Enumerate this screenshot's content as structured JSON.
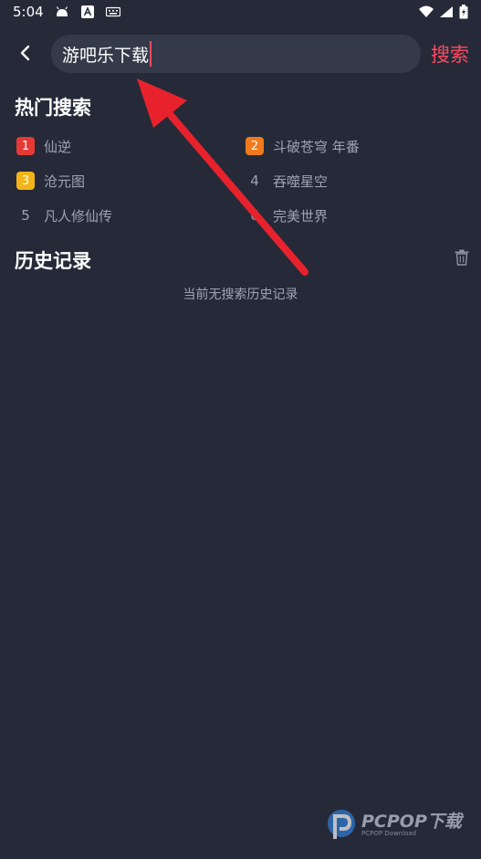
{
  "status_bar": {
    "time": "5:04",
    "left_icons": [
      "android-icon",
      "font-icon",
      "keyboard-icon"
    ],
    "right_icons": [
      "wifi-icon",
      "signal-icon",
      "battery-icon"
    ]
  },
  "search": {
    "value": "游吧乐下载",
    "button_label": "搜索"
  },
  "hot_search": {
    "title": "热门搜索",
    "items": [
      {
        "rank": "1",
        "label": "仙逆",
        "badge_color": "#e53935"
      },
      {
        "rank": "2",
        "label": "斗破苍穹 年番",
        "badge_color": "#f07a1c"
      },
      {
        "rank": "3",
        "label": "沧元图",
        "badge_color": "#f2b418"
      },
      {
        "rank": "4",
        "label": "吞噬星空"
      },
      {
        "rank": "5",
        "label": "凡人修仙传"
      },
      {
        "rank": "6",
        "label": "完美世界"
      }
    ]
  },
  "history": {
    "title": "历史记录",
    "empty_text": "当前无搜索历史记录"
  },
  "watermark": {
    "text": "PCPOP下载",
    "subtext": "PCPOP Download"
  },
  "colors": {
    "background": "#262a38",
    "accent": "#ff4a5e",
    "annotation_arrow": "#e8222d"
  }
}
